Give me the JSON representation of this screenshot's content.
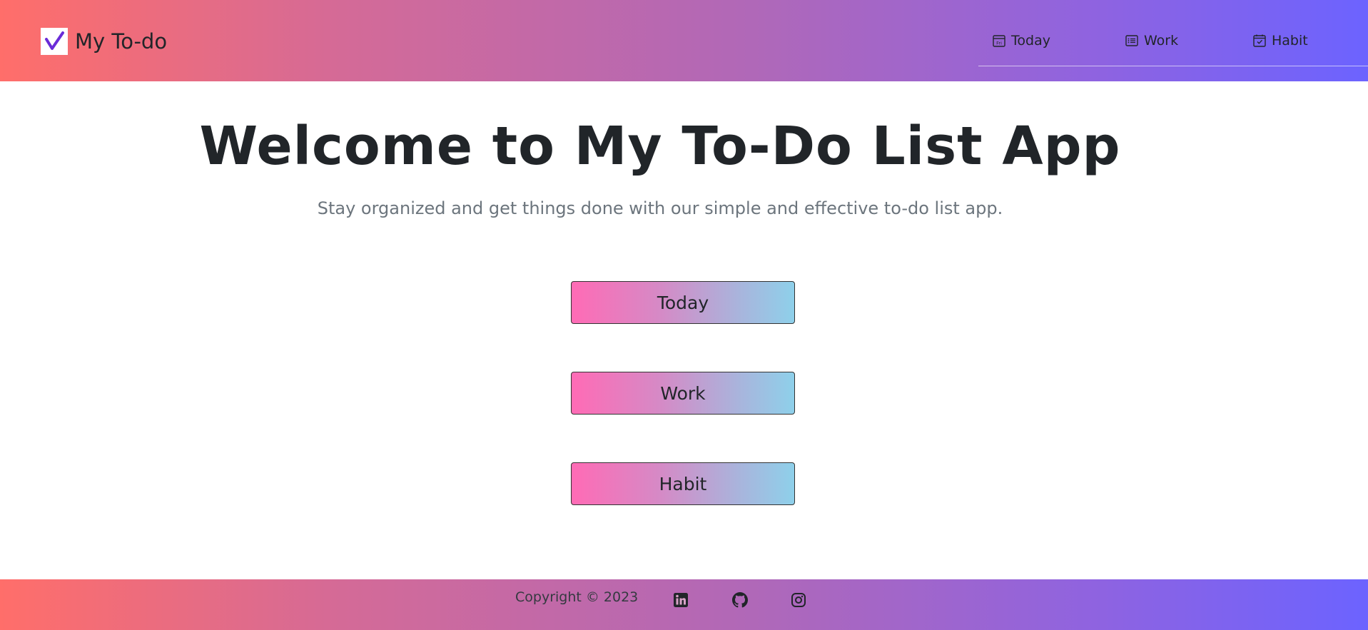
{
  "header": {
    "brand_name": "My To-do",
    "brand_icon": "check-icon",
    "nav": [
      {
        "label": "Today",
        "icon": "calendar-fri-icon"
      },
      {
        "label": "Work",
        "icon": "list-icon"
      },
      {
        "label": "Habit",
        "icon": "calendar-check-icon"
      }
    ]
  },
  "hero": {
    "title": "Welcome to My To-Do List App",
    "subtitle": "Stay organized and get things done with our simple and effective to-do list app."
  },
  "categories": [
    {
      "label": "Today"
    },
    {
      "label": "Work"
    },
    {
      "label": "Habit"
    }
  ],
  "footer": {
    "copyright": "Copyright © 2023",
    "social": [
      "linkedin-icon",
      "github-icon",
      "instagram-icon"
    ]
  },
  "colors": {
    "gradient_start": "#ff6e6a",
    "gradient_end": "#6c63ff",
    "check_color": "#6a2cd8",
    "button_gradient_start": "#ff6bb5",
    "button_gradient_end": "#8ed0ea"
  }
}
